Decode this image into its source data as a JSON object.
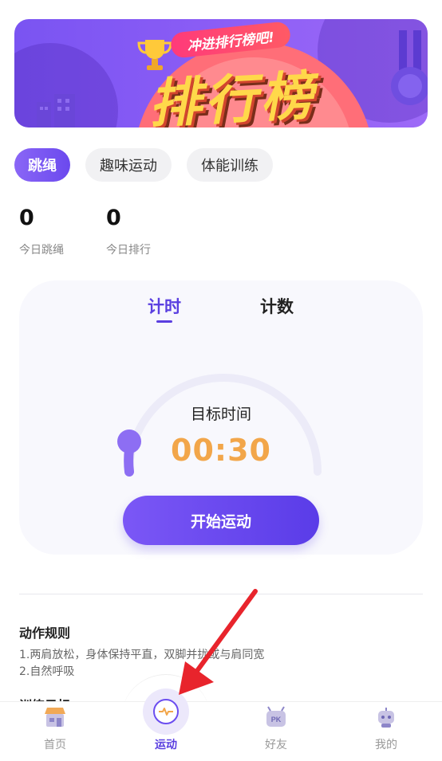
{
  "banner": {
    "ribbon_text": "冲进排行榜吧!",
    "title": "排行榜"
  },
  "categories": [
    {
      "label": "跳绳",
      "active": true
    },
    {
      "label": "趣味运动",
      "active": false
    },
    {
      "label": "体能训练",
      "active": false
    }
  ],
  "stats": [
    {
      "value": "0",
      "label": "今日跳绳"
    },
    {
      "value": "0",
      "label": "今日排行"
    }
  ],
  "modes": [
    {
      "label": "计时",
      "active": true
    },
    {
      "label": "计数",
      "active": false
    }
  ],
  "timer": {
    "target_label": "目标时间",
    "time_value": "00:30"
  },
  "start_button": "开始运动",
  "rules": {
    "title": "动作规则",
    "items": [
      "1.两肩放松，身体保持平直，双脚并拢或与肩同宽",
      "2.自然呼吸"
    ],
    "next_title": "训练目标"
  },
  "bottom_nav": [
    {
      "label": "首页",
      "icon": "store-icon",
      "active": false
    },
    {
      "label": "运动",
      "icon": "pulse-icon",
      "active": true
    },
    {
      "label": "好友",
      "icon": "pk-icon",
      "active": false
    },
    {
      "label": "我的",
      "icon": "robot-icon",
      "active": false
    }
  ],
  "colors": {
    "accent": "#5a3fe0",
    "banner": "#8a5cf5",
    "timer": "#f2a64a",
    "annotation_arrow": "#e8242c"
  }
}
